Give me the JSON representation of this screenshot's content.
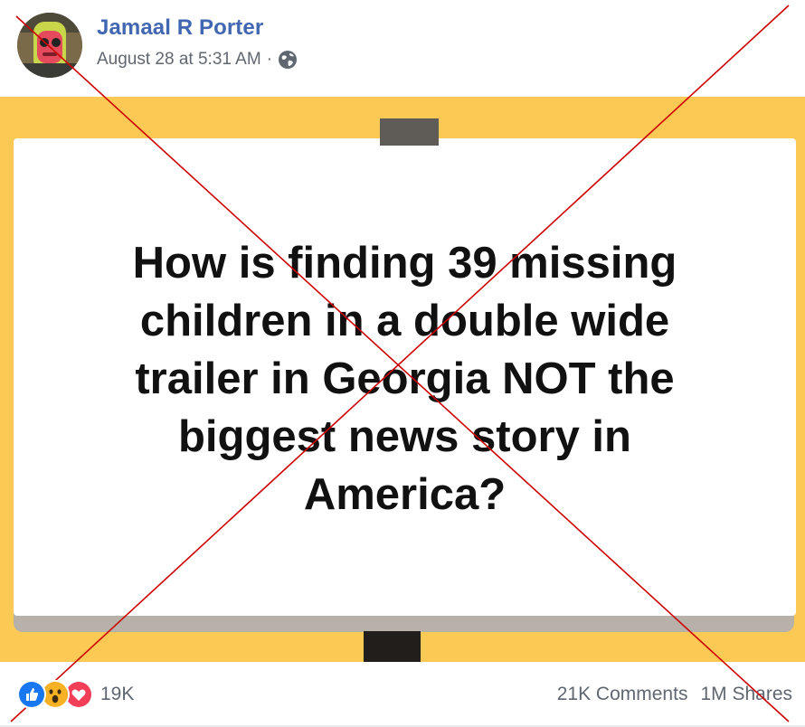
{
  "post": {
    "author": "Jamaal R Porter",
    "timestamp": "August 28 at 5:31 AM",
    "separator": "·",
    "privacy_icon": "globe-icon",
    "image_text_lines": [
      "How is finding 39 missing",
      "children in a double wide",
      "trailer in Georgia NOT the",
      "biggest news story in",
      "America?"
    ]
  },
  "footer": {
    "reactions": [
      "like-icon",
      "wow-icon",
      "love-icon"
    ],
    "reaction_count": "19K",
    "comments": "21K Comments",
    "shares": "1M Shares"
  },
  "colors": {
    "name": "#4267b2",
    "meta": "#616770",
    "image_background": "#fcc955",
    "cross": "#cc0000",
    "like": "#1877f2",
    "wow": "#f7b125",
    "love": "#f33e58"
  }
}
